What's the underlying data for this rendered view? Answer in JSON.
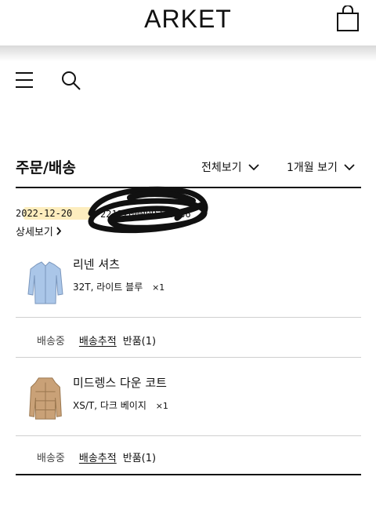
{
  "header": {
    "brand": "ARKET",
    "bag_icon": "shopping-bag-icon",
    "menu_icon": "hamburger-menu-icon",
    "search_icon": "search-icon"
  },
  "orders": {
    "title": "주문/배송",
    "filter_all": "전체보기",
    "filter_period": "1개월 보기",
    "order_date": "2022-12-20",
    "order_number": "2212200009246166",
    "detail_link": "상세보기"
  },
  "items": [
    {
      "name": "리넨 셔츠",
      "option": "32T, 라이트 블루",
      "qty": "×1",
      "status": "배송중",
      "track_label": "배송추적",
      "return_label": "반품(1)",
      "color": "#aac6e8"
    },
    {
      "name": "미드렝스 다운 코트",
      "option": "XS/T, 다크 베이지",
      "qty": "×1",
      "status": "배송중",
      "track_label": "배송추적",
      "return_label": "반품(1)",
      "color": "#c9a177"
    }
  ],
  "colors": {
    "highlight": "#fad76e",
    "text": "#111111",
    "divider": "#cfcfcf"
  }
}
